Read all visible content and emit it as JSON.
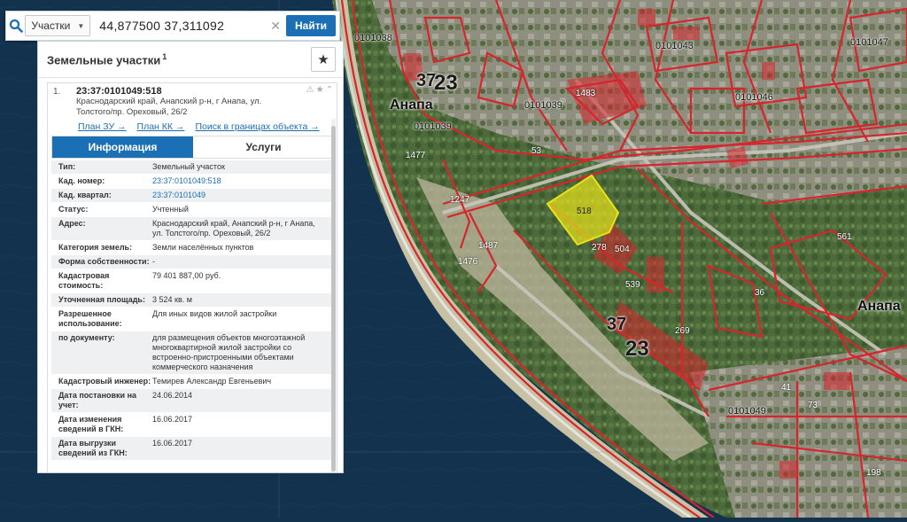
{
  "search": {
    "type_label": "Участки",
    "query": "44,877500 37,311092",
    "button": "Найти"
  },
  "panel": {
    "title": "Земельные участки",
    "count": "1"
  },
  "result": {
    "index": "1.",
    "cad_number": "23:37:0101049:518",
    "address": "Краснодарский край, Анапский р-н, г Анапа, ул. Толстого/пр. Ореховый, 26/2",
    "links": [
      "План ЗУ →",
      "План КК →",
      "Поиск в границах объекта →"
    ],
    "tabs": [
      "Информация",
      "Услуги"
    ],
    "rows": [
      {
        "k": "Тип:",
        "v": "Земельный участок"
      },
      {
        "k": "Кад. номер:",
        "v": "23:37:0101049:518",
        "link": true
      },
      {
        "k": "Кад. квартал:",
        "v": "23:37:0101049",
        "link": true
      },
      {
        "k": "Статус:",
        "v": "Учтенный"
      },
      {
        "k": "Адрес:",
        "v": "Краснодарский край, Анапский р-н, г Анапа, ул. Толстого/пр. Ореховый, 26/2"
      },
      {
        "k": "Категория земель:",
        "v": "Земли населённых пунктов"
      },
      {
        "k": "Форма собственности:",
        "v": "-"
      },
      {
        "k": "Кадастровая стоимость:",
        "v": "79 401 887,00 руб."
      },
      {
        "k": "Уточненная площадь:",
        "v": "3 524 кв. м"
      },
      {
        "k": "Разрешенное использование:",
        "v": "Для иных видов жилой застройки"
      },
      {
        "k": "по документу:",
        "v": "для размещения объектов многоэтажной многоквартирной жилой застройки со встроенно-пристроенными объектами коммерческого назначения"
      },
      {
        "k": "Кадастровый инженер:",
        "v": "Темирев Александр Евгеньевич"
      },
      {
        "k": "Дата постановки на учет:",
        "v": "24.06.2014"
      },
      {
        "k": "Дата изменения сведений в ГКН:",
        "v": "16.06.2017"
      },
      {
        "k": "Дата выгрузки сведений из ГКН:",
        "v": "16.06.2017"
      }
    ]
  },
  "map": {
    "labels": {
      "city_a": "Анапа",
      "city_b": "Анапа",
      "region_37_top": "37",
      "region_23_top": "23",
      "region_37_mid": "37",
      "region_23_mid": "23",
      "block_0101038": "0101038",
      "block_0101039_a": "0101039",
      "block_0101039_b": "0101039",
      "block_0101043": "0101043",
      "block_0101046": "0101046",
      "block_0101047": "0101047",
      "block_0101049": "0101049",
      "p_518": "518",
      "p_278": "278",
      "p_504": "504",
      "p_539": "539",
      "p_269": "269",
      "p_36": "36",
      "p_561": "561",
      "p_1483": "1483",
      "p_53": "53",
      "p_1477": "1477",
      "p_1476": "1476",
      "p_1487": "1487",
      "p_1247": "1247",
      "p_73": "73",
      "p_198": "198",
      "p_41": "41"
    },
    "colors": {
      "sea": "#12324d",
      "boundary": "#d8242d",
      "highlight": "#e8e21a"
    }
  }
}
